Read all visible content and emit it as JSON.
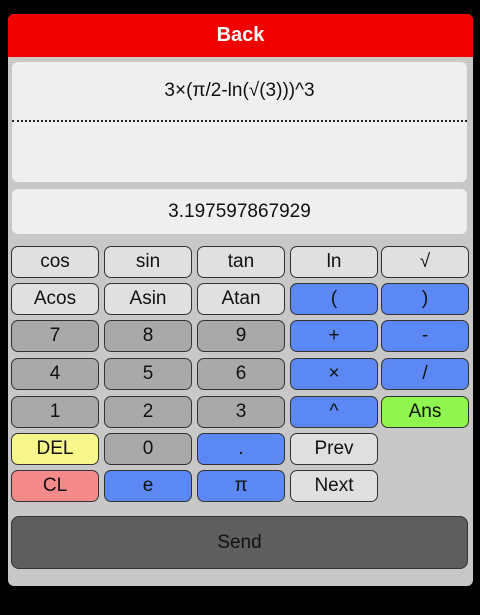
{
  "header": {
    "back_label": "Back"
  },
  "display": {
    "expression": "3×(π/2-ln(√(3)))^3",
    "result": "3.197597867929"
  },
  "keypad": [
    [
      "cos",
      "sin",
      "tan",
      "ln",
      "√"
    ],
    [
      "Acos",
      "Asin",
      "Atan",
      "(",
      ")"
    ],
    [
      "7",
      "8",
      "9",
      "+",
      "-"
    ],
    [
      "4",
      "5",
      "6",
      "×",
      "/"
    ],
    [
      "1",
      "2",
      "3",
      "^",
      "Ans"
    ],
    [
      "DEL",
      "0",
      ".",
      "Prev"
    ],
    [
      "CL",
      "e",
      "π",
      "Next"
    ]
  ],
  "footer": {
    "send_label": "Send"
  },
  "colors": {
    "header_red": "#f20000",
    "operator_blue": "#5b88f2",
    "ans_green": "#90f550",
    "del_yellow": "#f6f68a",
    "clear_red": "#f58a8a"
  }
}
